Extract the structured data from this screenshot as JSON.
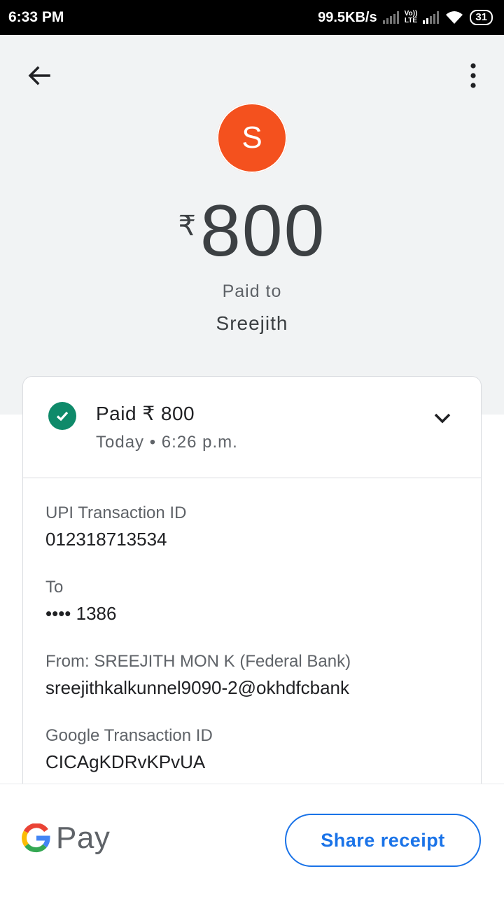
{
  "status_bar": {
    "time": "6:33 PM",
    "speed": "99.5KB/s",
    "volte_top": "Vo))",
    "volte_bottom": "LTE",
    "battery": "31"
  },
  "header": {
    "avatar_letter": "S",
    "avatar_color": "#f4511e",
    "currency": "₹",
    "amount": "800",
    "paid_to_label": "Paid to",
    "payee": "Sreejith"
  },
  "card": {
    "status_title": "Paid ₹ 800",
    "status_time": "Today • 6:26 p.m.",
    "details": [
      {
        "label": "UPI Transaction ID",
        "value": "012318713534"
      },
      {
        "label": "To",
        "value": "•••• 1386"
      },
      {
        "label": "From: SREEJITH MON K (Federal Bank)",
        "value": "sreejithkalkunnel9090-2@okhdfcbank"
      },
      {
        "label": "Google Transaction ID",
        "value": "CICAgKDRvKPvUA"
      }
    ]
  },
  "footer": {
    "brand_pay": "Pay",
    "share_label": "Share receipt",
    "accent": "#1a73e8"
  }
}
